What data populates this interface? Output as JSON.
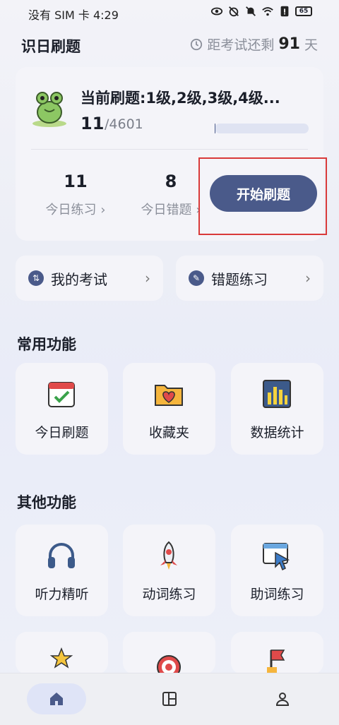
{
  "status": {
    "carrier_time": "没有 SIM 卡 4:29",
    "battery": "65"
  },
  "header": {
    "title": "识日刷题",
    "countdown_prefix": "距考试还剩",
    "countdown_days": "91",
    "countdown_unit": "天"
  },
  "main_card": {
    "current_label": "当前刷题:1级,2级,3级,4级...",
    "progress_count": "11",
    "progress_total": "/4601",
    "progress_fraction": 0.0024,
    "today_practice_value": "11",
    "today_practice_label": "今日练习 ›",
    "today_wrong_value": "8",
    "today_wrong_label": "今日错题 ›",
    "start_button": "开始刷题"
  },
  "quick_links": [
    {
      "label": "我的考试"
    },
    {
      "label": "错题练习"
    }
  ],
  "sections": {
    "common": "常用功能",
    "other": "其他功能"
  },
  "common_tiles": [
    {
      "label": "今日刷题",
      "icon": "calendar-check-icon"
    },
    {
      "label": "收藏夹",
      "icon": "heart-folder-icon"
    },
    {
      "label": "数据统计",
      "icon": "bar-chart-icon"
    }
  ],
  "other_tiles": [
    {
      "label": "听力精听",
      "icon": "headphones-icon"
    },
    {
      "label": "动词练习",
      "icon": "rocket-icon"
    },
    {
      "label": "助词练习",
      "icon": "cursor-click-icon"
    }
  ],
  "colors": {
    "accent": "#4a5a8a",
    "highlight": "#d93a3a"
  }
}
